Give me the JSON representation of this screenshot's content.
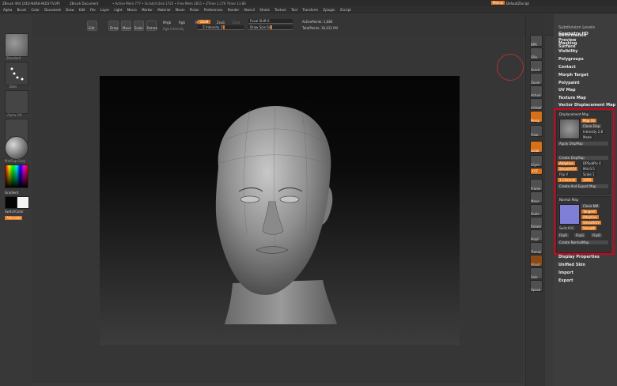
{
  "titlebar": {
    "app": "ZBrush 4R4 [Z4Q-N4R8-AKD3-TVUP]",
    "doc": "ZBrush Document",
    "stats": "• Active Mem 777  • Scratch Disk 1725  • Free Mem 2651  • ZTime 1.176  Timer 13.86",
    "menus_btn": "Menus",
    "script": "DefaultZScript"
  },
  "menubar": [
    "Alpha",
    "Brush",
    "Color",
    "Document",
    "Draw",
    "Edit",
    "File",
    "Layer",
    "Light",
    "Macro",
    "Marker",
    "Material",
    "Movie",
    "Picker",
    "Preferences",
    "Render",
    "Stencil",
    "Stroke",
    "Texture",
    "Tool",
    "Transform",
    "Zplugin",
    "Zscript"
  ],
  "toolbar": {
    "projection": "Projection Master",
    "edit": "Edit",
    "draw": "Draw",
    "move": "Move",
    "scale": "Scale",
    "rotate": "Rotate",
    "mrgb": "Mrgb",
    "rgb": "Rgb",
    "m": "M",
    "rgb_intensity": "Rgb Intensity",
    "zadd": "Zadd",
    "zsub": "Zsub",
    "zcut": "Zcut",
    "z_intensity": "Z Intensity 25",
    "focal_shift": "Focal Shift 0",
    "draw_size": "Draw Size 64",
    "active_points": "ActivePoints: 1,684",
    "total_points": "TotalPoints: 16,012 Mil"
  },
  "leftpanel": {
    "labels": [
      "Standard",
      "Dots",
      "Alpha Off",
      "Texture Off",
      "MatCap Gray"
    ],
    "gradient": "Gradient",
    "switch_color": "SwitchColor",
    "alternate": "Alternate"
  },
  "shelf": [
    "BPR",
    "SPix",
    "Scroll",
    "Zoom",
    "Actual",
    "AAHalf",
    "Persp",
    "Floor",
    "Local",
    "LSym",
    "XYZ",
    "Frame",
    "Move",
    "Scale",
    "Rotate",
    "PolyF",
    "Transp",
    "Ghost",
    "Solo",
    "Xpose"
  ],
  "tray": {
    "top": "Subdivision Levels",
    "items": [
      "Geometry HD",
      "Preview",
      "Surface",
      "Deformation",
      "Masking",
      "Visibility",
      "Polygroups",
      "Contact",
      "Morph Target",
      "Polypaint",
      "UV Map",
      "Texture Map",
      "Vector Displacement Map"
    ],
    "displacement": {
      "header": "Displacement Map",
      "map_on": "Map On",
      "clone_disp": "Clone Disp",
      "intensity": "Intensity 2.8",
      "mode": "Mode",
      "apply": "Apply DispMap",
      "create": "Create DispMap",
      "adaptive": "Adaptive",
      "dpsubpix": "DPSubPix 4",
      "smooth_uv": "SmoothUV",
      "mid": "Mid 0.5",
      "flip_v": "Flip V",
      "scale": "Scale 1",
      "channels": "1 Channel",
      "bit": "32Bit",
      "export": "Create And Export Map"
    },
    "normal": {
      "header": "Normal Map",
      "clone_nm": "Clone NM",
      "tangent": "Tangent",
      "adaptive": "Adaptive",
      "smooth_uv": "SmoothUV",
      "switch_rg": "SwitchRG",
      "flip_r": "FlipR",
      "flip_g": "FlipG",
      "flip_b": "FlipB",
      "smooth": "Smooth",
      "create": "Create NormalMap"
    },
    "after": [
      "Display Properties",
      "Unified Skin",
      "Import",
      "Export"
    ]
  },
  "colors": {
    "accent": "#e07820",
    "highlight": "#d0021b"
  }
}
